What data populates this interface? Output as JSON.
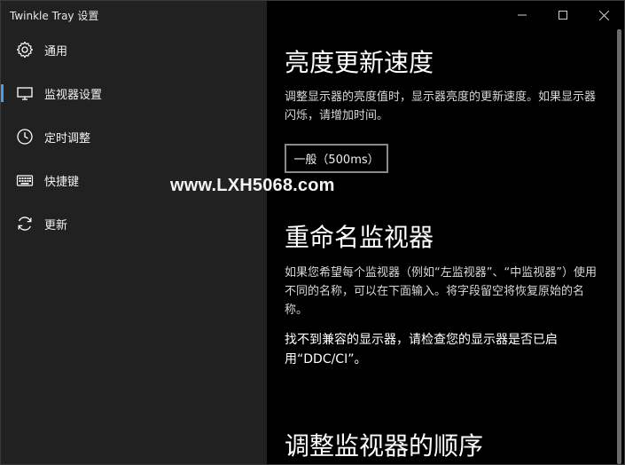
{
  "window": {
    "title": "Twinkle Tray 设置"
  },
  "sidebar": {
    "items": [
      {
        "label": "通用",
        "icon": "gear-icon"
      },
      {
        "label": "监视器设置",
        "icon": "monitor-icon",
        "active": true
      },
      {
        "label": "定时调整",
        "icon": "clock-icon"
      },
      {
        "label": "快捷键",
        "icon": "keyboard-icon"
      },
      {
        "label": "更新",
        "icon": "refresh-icon"
      }
    ]
  },
  "watermark": "www.LXH5068.com",
  "content": {
    "update_speed": {
      "heading": "亮度更新速度",
      "description": "调整显示器的亮度值时，显示器亮度的更新速度。如果显示器闪烁，请增加时间。",
      "select_value": "一般（500ms）"
    },
    "rename": {
      "heading": "重命名监视器",
      "description": "如果您希望每个监视器（例如“左监视器”、“中监视器”）使用不同的名称，可以在下面输入。将字段留空将恢复原始的名称。",
      "warning": "找不到兼容的显示器，请检查您的显示器是否已启用“DDC/CI”。"
    },
    "reorder": {
      "heading": "调整监视器的顺序"
    }
  },
  "colors": {
    "sidebar_bg": "#212121",
    "content_bg": "#000000",
    "accent": "#4a9be8"
  }
}
